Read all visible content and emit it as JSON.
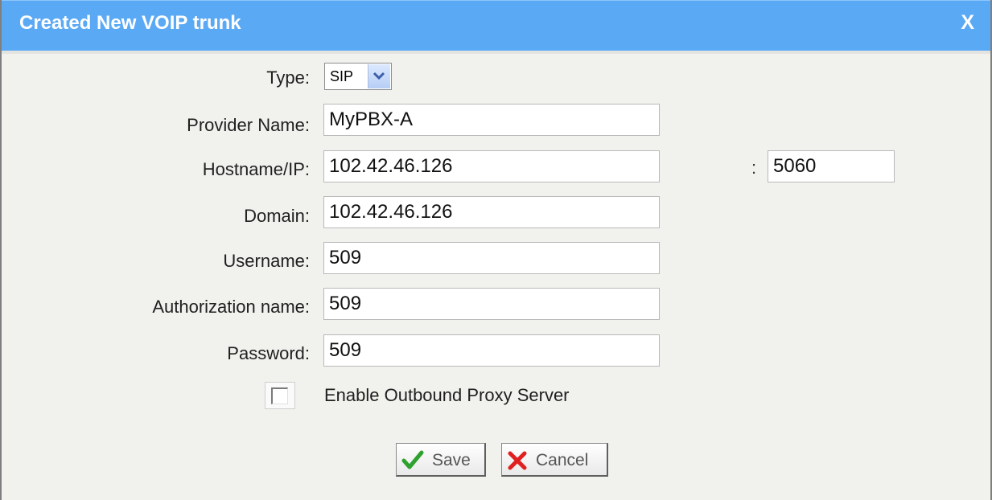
{
  "dialog": {
    "title": "Created New VOIP trunk",
    "close_label": "X"
  },
  "form": {
    "type": {
      "label": "Type:",
      "value": "SIP"
    },
    "provider_name": {
      "label": "Provider Name:",
      "value": "MyPBX-A"
    },
    "hostname": {
      "label": "Hostname/IP:",
      "value": "102.42.46.126",
      "port_separator": ":",
      "port": "5060"
    },
    "domain": {
      "label": "Domain:",
      "value": "102.42.46.126"
    },
    "username": {
      "label": "Username:",
      "value": "509"
    },
    "authorization_name": {
      "label": "Authorization name:",
      "value": "509"
    },
    "password": {
      "label": "Password:",
      "value": "509"
    },
    "outbound_proxy": {
      "label": "Enable Outbound Proxy Server",
      "checked": false
    }
  },
  "buttons": {
    "save_label": "Save",
    "cancel_label": "Cancel"
  },
  "colors": {
    "titlebar": "#5aa9f5",
    "save_icon": "#2ea12e",
    "cancel_icon": "#e02020"
  }
}
